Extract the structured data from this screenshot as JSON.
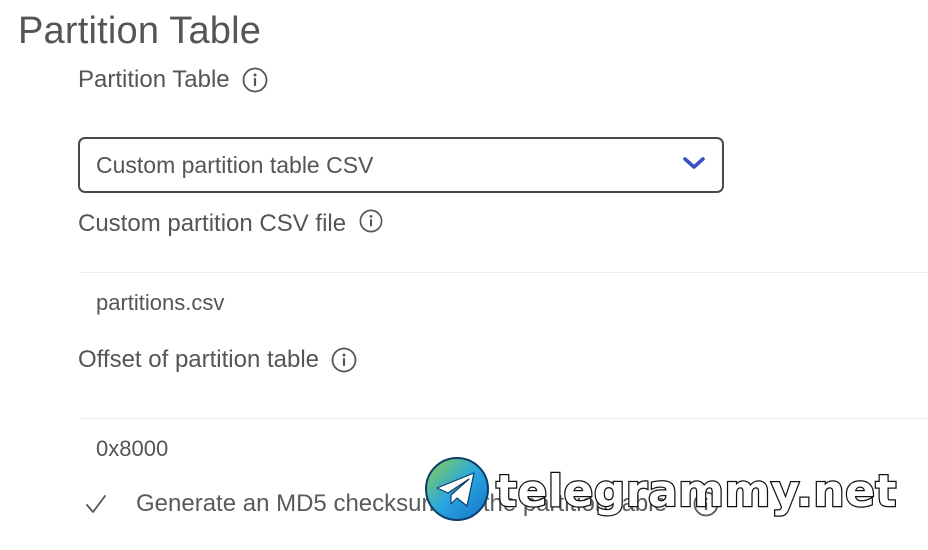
{
  "section": {
    "title": "Partition Table"
  },
  "partition_table": {
    "label": "Partition Table",
    "selected": "Custom partition table CSV"
  },
  "custom_csv": {
    "label": "Custom partition CSV file",
    "value": "partitions.csv"
  },
  "offset": {
    "label": "Offset of partition table",
    "value": "0x8000"
  },
  "md5": {
    "label": "Generate an MD5 checksum for the partition table",
    "checked": true
  },
  "watermark": {
    "text": "telegrammy.net"
  },
  "colors": {
    "chevron": "#3b4cca",
    "text": "#555555",
    "border": "#4a4a4a"
  }
}
